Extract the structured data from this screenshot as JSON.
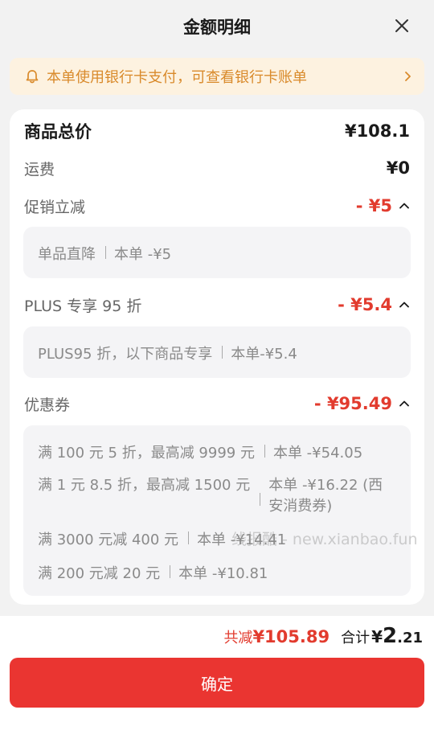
{
  "header": {
    "title": "金额明细"
  },
  "notice": {
    "text": "本单使用银行卡支付，可查看银行卡账单"
  },
  "summary": {
    "total_label": "商品总价",
    "total_value": "¥108.1",
    "shipping_label": "运费",
    "shipping_value": "¥0"
  },
  "promo": {
    "label": "促销立减",
    "value": "- ¥5",
    "details": [
      {
        "desc": "单品直降",
        "value": "本单 -¥5"
      }
    ]
  },
  "plus": {
    "label": "PLUS 专享 95 折",
    "value": "- ¥5.4",
    "details": [
      {
        "desc": "PLUS95 折，以下商品专享",
        "value": "本单-¥5.4"
      }
    ]
  },
  "coupon": {
    "label": "优惠券",
    "value": "- ¥95.49",
    "details": [
      {
        "desc": "满 100 元 5 折，最高减 9999 元",
        "value": "本单 -¥54.05"
      },
      {
        "desc": "满 1 元 8.5 折，最高减 1500 元",
        "value": "本单 -¥16.22 (西安消费券)"
      },
      {
        "desc": "满 3000 元减 400 元",
        "value": "本单 -¥14.41"
      },
      {
        "desc": "满 200 元减 20 元",
        "value": "本单 -¥10.81"
      }
    ]
  },
  "watermark": "线报酷 - new.xianbao.fun",
  "footer": {
    "reduce_label": "共减",
    "reduce_value": "¥105.89",
    "sum_label": "合计",
    "sum_symbol": "¥",
    "sum_int": "2",
    "sum_dec": ".21",
    "confirm_label": "确定"
  },
  "colors": {
    "accent_red": "#e23b2e",
    "button_red": "#ea3531",
    "notice_orange": "#d98a2b",
    "notice_bg": "#fdf2e0"
  },
  "icons": {
    "close": "close-icon",
    "bell": "bell-icon",
    "chevron": "chevron-right-icon",
    "caret": "chevron-up-icon"
  }
}
